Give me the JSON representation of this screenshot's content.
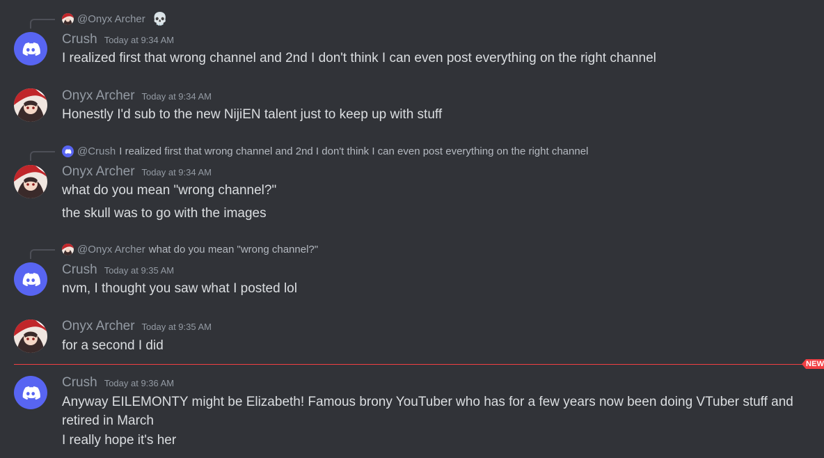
{
  "channel": {
    "new_label": "NEW"
  },
  "messages": [
    {
      "reply": {
        "name": "@Onyx Archer",
        "text": "",
        "trailing_icon": "skull-icon"
      },
      "author": "Crush",
      "timestamp": "Today at 9:34 AM",
      "avatar": "discord-logo-icon",
      "lines": [
        "I realized first that wrong channel and 2nd I don't think I can even post everything on the right channel"
      ]
    },
    {
      "author": "Onyx Archer",
      "timestamp": "Today at 9:34 AM",
      "avatar": "anime-avatar",
      "lines": [
        "Honestly I'd sub to the new NijiEN talent just to keep up with stuff"
      ]
    },
    {
      "reply": {
        "name": "@Crush",
        "text": "I realized first that wrong channel and 2nd I don't think I can even post everything on the right channel"
      },
      "author": "Onyx Archer",
      "timestamp": "Today at 9:34 AM",
      "avatar": "anime-avatar",
      "lines": [
        "what do you mean \"wrong channel?\"",
        "the skull was to go with the images"
      ]
    },
    {
      "reply": {
        "name": "@Onyx Archer",
        "text": "what do you mean \"wrong channel?\""
      },
      "author": "Crush",
      "timestamp": "Today at 9:35 AM",
      "avatar": "discord-logo-icon",
      "lines": [
        "nvm, I thought you saw what I posted lol"
      ]
    },
    {
      "author": "Onyx Archer",
      "timestamp": "Today at 9:35 AM",
      "avatar": "anime-avatar",
      "lines": [
        "for a second I did"
      ]
    },
    {
      "author": "Crush",
      "timestamp": "Today at 9:36 AM",
      "avatar": "discord-logo-icon",
      "lines": [
        "Anyway EILEMONTY might be Elizabeth! Famous brony YouTuber who has for a few years now been doing VTuber stuff and",
        "retired in March",
        "I really hope it's her"
      ]
    }
  ],
  "colors": {
    "background": "#313338",
    "discord_blurple": "#5865f2",
    "new_divider": "#f23f43",
    "username_muted": "#949ba4",
    "message_text": "#dbdee1"
  }
}
